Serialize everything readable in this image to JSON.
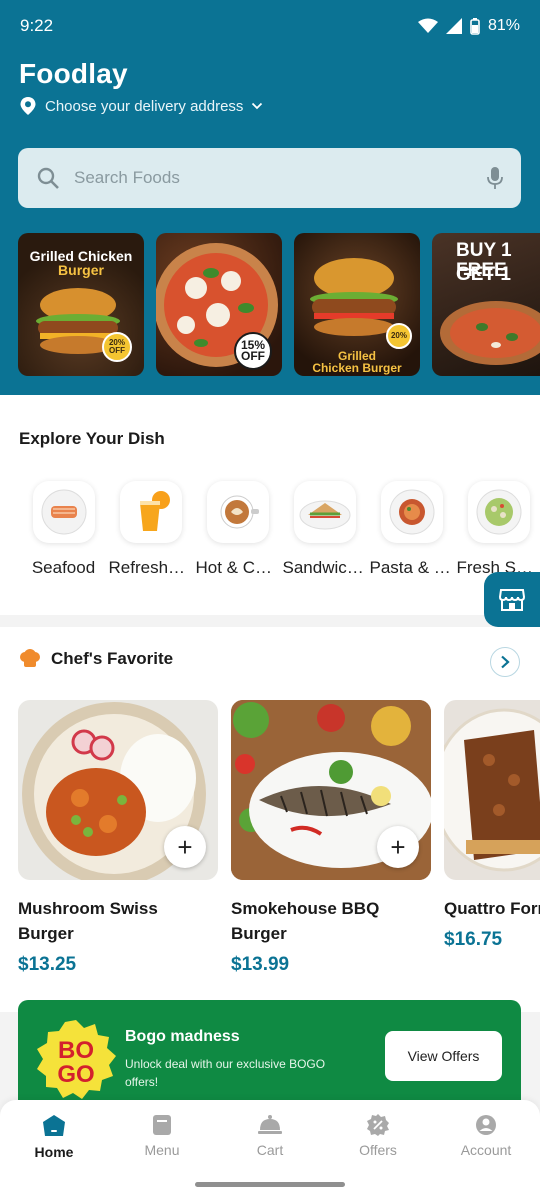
{
  "status_bar": {
    "time": "9:22",
    "battery": "81%"
  },
  "header": {
    "app_title": "Foodlay",
    "address_label": "Choose your delivery address",
    "search_placeholder": "Search Foods"
  },
  "banners": [
    {
      "title": "Grilled Chicken",
      "subtitle": "Burger",
      "badge": "20% OFF"
    },
    {
      "badge": "15% OFF"
    },
    {
      "title": "Grilled",
      "subtitle": "Chicken Burger",
      "badge": "20%"
    },
    {
      "title": "BUY 1 FREE",
      "subtitle": "GET 1"
    }
  ],
  "explore": {
    "title": "Explore Your Dish",
    "dishes": [
      {
        "label": "Seafood",
        "icon": "salmon-plate-icon"
      },
      {
        "label": "Refreshments",
        "icon": "orange-juice-icon"
      },
      {
        "label": "Hot & Coffee",
        "icon": "coffee-cup-icon"
      },
      {
        "label": "Sandwiches",
        "icon": "sandwich-plate-icon"
      },
      {
        "label": "Pasta & Noodles",
        "icon": "pasta-plate-icon"
      },
      {
        "label": "Fresh Salads",
        "icon": "salad-plate-icon"
      }
    ]
  },
  "chef": {
    "title": "Chef's Favorite",
    "products": [
      {
        "name": "Mushroom Swiss Burger",
        "price": "$13.25"
      },
      {
        "name": "Smokehouse BBQ Burger",
        "price": "$13.99"
      },
      {
        "name": "Quattro Formaggi",
        "price": "$16.75"
      }
    ]
  },
  "bogo": {
    "logo_top": "BO",
    "logo_bottom": "GO",
    "title": "Bogo madness",
    "description": "Unlock deal with our exclusive BOGO offers!",
    "button": "View Offers"
  },
  "nav": {
    "items": [
      {
        "label": "Home",
        "icon": "home-icon"
      },
      {
        "label": "Menu",
        "icon": "menu-icon"
      },
      {
        "label": "Cart",
        "icon": "cart-icon"
      },
      {
        "label": "Offers",
        "icon": "offers-icon"
      },
      {
        "label": "Account",
        "icon": "account-icon"
      }
    ]
  },
  "colors": {
    "brand": "#0b7394",
    "bogo": "#0f8a43",
    "accent": "#f4c531"
  }
}
